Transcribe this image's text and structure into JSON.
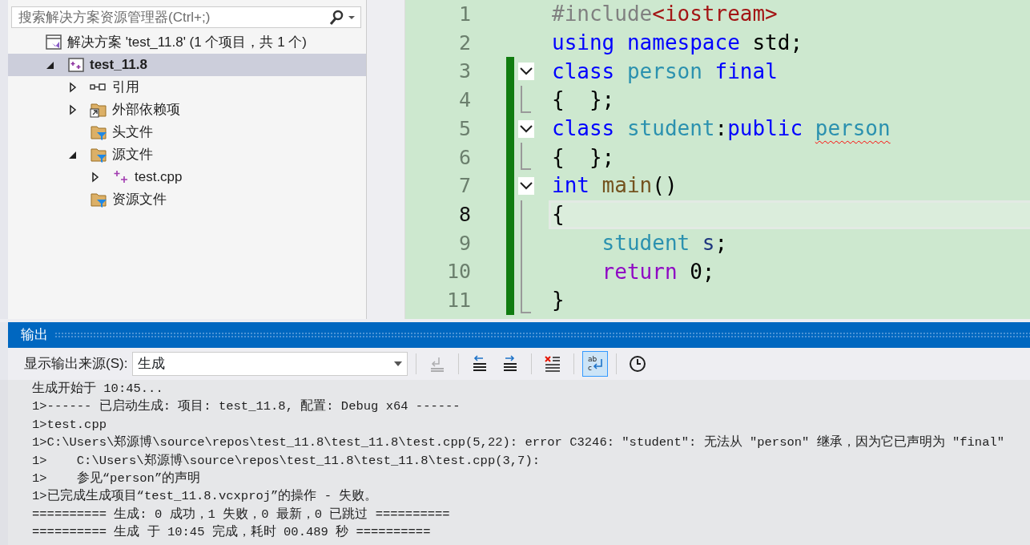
{
  "solution_explorer": {
    "search": {
      "placeholder": "搜索解决方案资源管理器(Ctrl+;)"
    },
    "tree": [
      {
        "label": "解决方案 'test_11.8' (1 个项目，共 1 个)",
        "kind": "solution",
        "selected": false,
        "children": [
          {
            "label": "test_11.8",
            "kind": "project",
            "selected": true,
            "expanded": true,
            "children": [
              {
                "label": "引用",
                "kind": "references",
                "selected": false,
                "expanded": false
              },
              {
                "label": "外部依赖项",
                "kind": "external",
                "selected": false,
                "expanded": false
              },
              {
                "label": "头文件",
                "kind": "filter",
                "selected": false
              },
              {
                "label": "源文件",
                "kind": "filter",
                "selected": false,
                "expanded": true,
                "children": [
                  {
                    "label": "test.cpp",
                    "kind": "cpp",
                    "selected": false,
                    "expanded": false
                  }
                ]
              },
              {
                "label": "资源文件",
                "kind": "filter",
                "selected": false
              }
            ]
          }
        ]
      }
    ]
  },
  "editor": {
    "lines": [
      {
        "number": "1",
        "tokens": [
          {
            "text": "#include",
            "kind": "preproc"
          },
          {
            "text": "<iostream>",
            "kind": "string"
          }
        ]
      },
      {
        "number": "2",
        "tokens": [
          {
            "text": "using namespace",
            "kind": "keyword"
          },
          {
            "text": " std;",
            "kind": "plain"
          }
        ]
      },
      {
        "number": "3",
        "changed": true,
        "collapsible": true,
        "tokens": [
          {
            "text": "class",
            "kind": "keyword"
          },
          {
            "text": " person",
            "kind": "type"
          },
          {
            "text": " final",
            "kind": "keyword"
          }
        ]
      },
      {
        "number": "4",
        "changed": true,
        "tokens": [
          {
            "text": "{  };",
            "kind": "plain"
          }
        ]
      },
      {
        "number": "5",
        "changed": true,
        "collapsible": true,
        "tokens": [
          {
            "text": "class",
            "kind": "keyword"
          },
          {
            "text": " student",
            "kind": "type"
          },
          {
            "text": ":",
            "kind": "plain"
          },
          {
            "text": "public ",
            "kind": "keyword"
          },
          {
            "text": "person",
            "kind": "type",
            "error": true
          }
        ]
      },
      {
        "number": "6",
        "changed": true,
        "tokens": [
          {
            "text": "{  };",
            "kind": "plain"
          }
        ]
      },
      {
        "number": "7",
        "changed": true,
        "collapsible": true,
        "tokens": [
          {
            "text": "int",
            "kind": "keyword"
          },
          {
            "text": " main",
            "kind": "function"
          },
          {
            "text": "()",
            "kind": "plain"
          }
        ]
      },
      {
        "number": "8",
        "changed": true,
        "current": true,
        "tokens": [
          {
            "text": "{",
            "kind": "plain"
          }
        ]
      },
      {
        "number": "9",
        "changed": true,
        "tokens": [
          {
            "text": "    student",
            "kind": "type"
          },
          {
            "text": " s",
            "kind": "variable"
          },
          {
            "text": ";",
            "kind": "plain"
          }
        ]
      },
      {
        "number": "10",
        "changed": true,
        "tokens": [
          {
            "text": "    return",
            "kind": "control"
          },
          {
            "text": " 0;",
            "kind": "plain"
          }
        ]
      },
      {
        "number": "11",
        "changed": true,
        "tokens": [
          {
            "text": "}",
            "kind": "plain"
          }
        ]
      }
    ]
  },
  "output": {
    "title": "输出",
    "source_label": "显示输出来源(S):",
    "source_value": "生成",
    "toolbar": [
      {
        "kind": "goto-error",
        "disabled": true,
        "selected": false
      },
      {
        "kind": "prev",
        "disabled": false,
        "selected": false
      },
      {
        "kind": "next",
        "disabled": false,
        "selected": false
      },
      {
        "kind": "clear",
        "disabled": false,
        "selected": false
      },
      {
        "kind": "wrap",
        "disabled": false,
        "selected": true,
        "icon_text": [
          "ab",
          "c"
        ]
      },
      {
        "kind": "clock",
        "disabled": false,
        "selected": false
      }
    ],
    "lines": [
      "生成开始于 10:45...",
      "1>------ 已启动生成: 项目: test_11.8, 配置: Debug x64 ------",
      "1>test.cpp",
      "1>C:\\Users\\郑源博\\source\\repos\\test_11.8\\test_11.8\\test.cpp(5,22): error C3246: ″student″: 无法从 ″person″ 继承，因为它已声明为 ″final″",
      "1>    C:\\Users\\郑源博\\source\\repos\\test_11.8\\test_11.8\\test.cpp(3,7):",
      "1>    参见“person”的声明",
      "1>已完成生成项目“test_11.8.vcxproj”的操作 - 失败。",
      "========== 生成: 0 成功，1 失败，0 最新，0 已跳过 ==========",
      "========== 生成 于 10:45 完成，耗时 00.489 秒 =========="
    ]
  }
}
